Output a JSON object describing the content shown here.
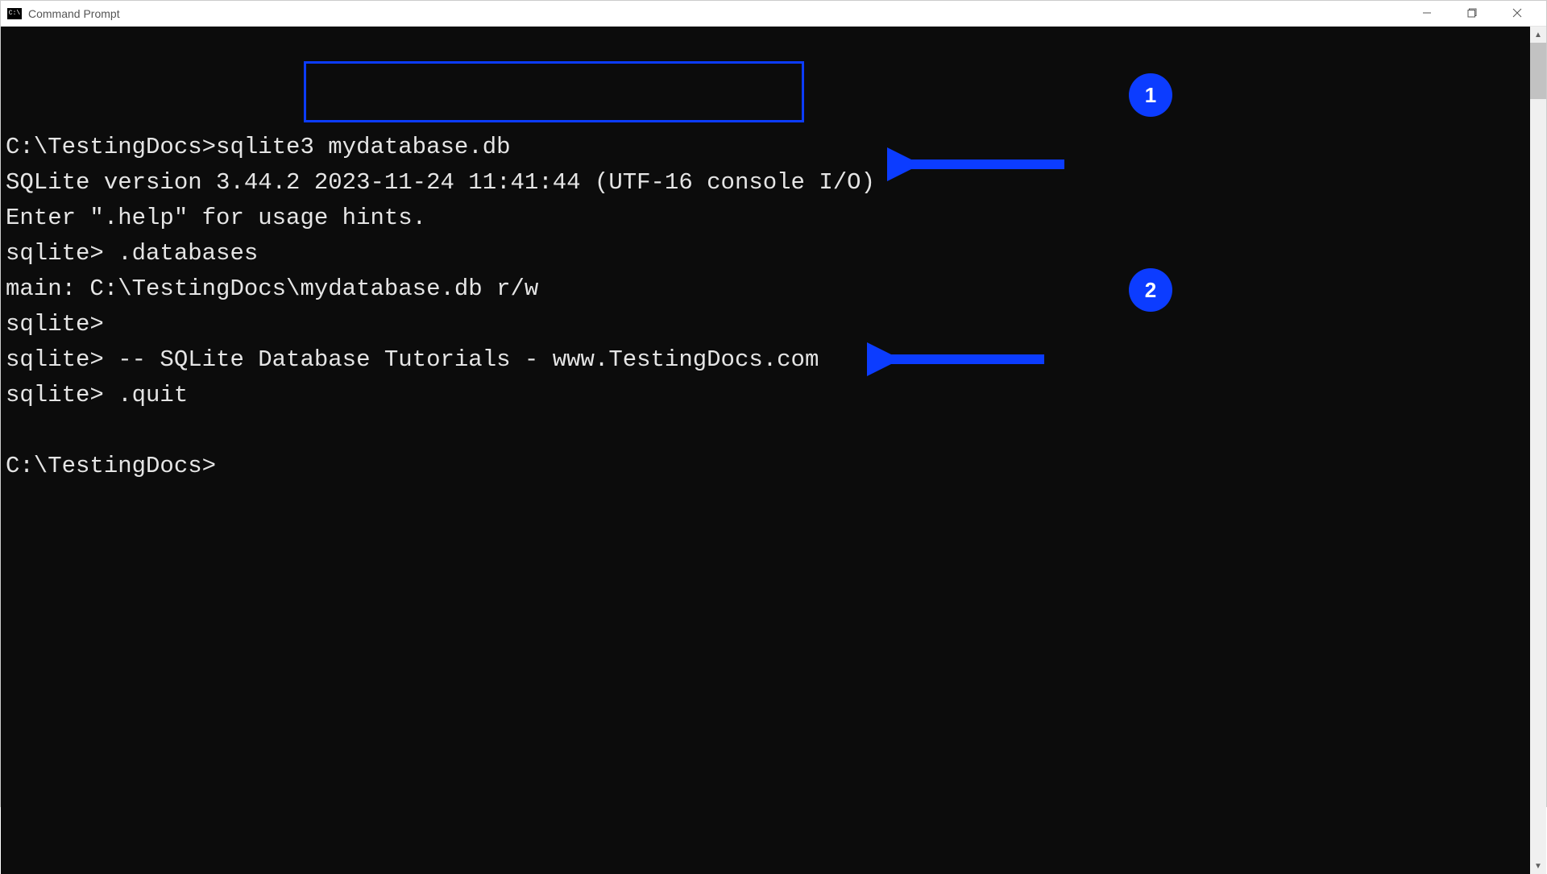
{
  "window": {
    "title": "Command Prompt"
  },
  "terminal": {
    "lines": [
      "",
      "C:\\TestingDocs>sqlite3 mydatabase.db",
      "SQLite version 3.44.2 2023-11-24 11:41:44 (UTF-16 console I/O)",
      "Enter \".help\" for usage hints.",
      "sqlite> .databases",
      "main: C:\\TestingDocs\\mydatabase.db r/w",
      "sqlite>",
      "sqlite> -- SQLite Database Tutorials - www.TestingDocs.com",
      "sqlite> .quit",
      "",
      "C:\\TestingDocs>"
    ]
  },
  "annotations": {
    "badge1": "1",
    "badge2": "2"
  },
  "colors": {
    "terminal_bg": "#0c0c0c",
    "terminal_fg": "#e5e5e5",
    "annotation_blue": "#0c3cff"
  }
}
